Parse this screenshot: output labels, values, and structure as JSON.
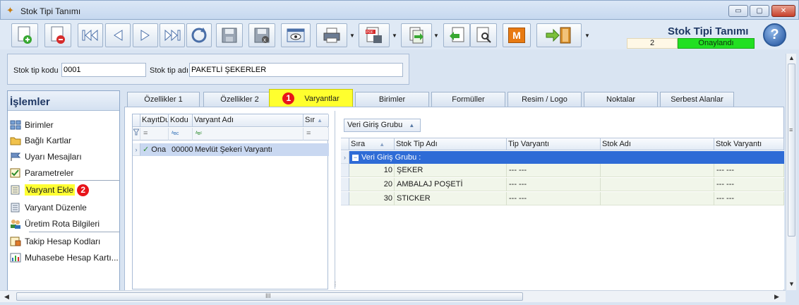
{
  "window": {
    "title": "Stok Tipi Tanımı",
    "minimize": "▭",
    "maximize": "▢",
    "close": "✕"
  },
  "toolbar": {
    "form_title": "Stok Tipi Tanımı",
    "record_number": "2",
    "status": "Onaylandı",
    "help_label": "?",
    "m_label": "M",
    "dropdown_arrow": "▼",
    "buttons": [
      "new-icon",
      "delete-icon",
      "first-icon",
      "prev-icon",
      "next-icon",
      "last-icon",
      "refresh-icon",
      "save-icon",
      "cancel-save-icon",
      "preview-icon",
      "print-icon",
      "pdf-icon",
      "export-icon",
      "import-icon",
      "tools-icon",
      "m-icon",
      "exit-icon"
    ]
  },
  "header": {
    "code_label": "Stok tip kodu",
    "code_value": "0001",
    "name_label": "Stok tip adı",
    "name_value": "PAKETLİ ŞEKERLER"
  },
  "left_panel": {
    "title": "İşlemler",
    "items": [
      {
        "label": "Birimler",
        "icon": "grid-icon"
      },
      {
        "label": "Bağlı Kartlar",
        "icon": "folder-icon"
      },
      {
        "label": "Uyarı Mesajları",
        "icon": "flag-icon"
      },
      {
        "label": "Parametreler",
        "icon": "checklist-icon"
      },
      {
        "label": "Varyant Ekle",
        "icon": "document-icon",
        "badge": "2"
      },
      {
        "label": "Varyant Düzenle",
        "icon": "document-icon"
      },
      {
        "label": "Üretim Rota Bilgileri",
        "icon": "users-icon"
      },
      {
        "label": "Takip Hesap Kodları",
        "icon": "ledger-icon"
      },
      {
        "label": "Muhasebe Hesap Kartı...",
        "icon": "chart-icon"
      }
    ]
  },
  "tabs": [
    {
      "label": "Özellikler 1"
    },
    {
      "label": "Özellikler 2"
    },
    {
      "label": "Varyantlar",
      "badge": "1"
    },
    {
      "label": "Birimler"
    },
    {
      "label": "Formüller"
    },
    {
      "label": "Resim / Logo"
    },
    {
      "label": "Noktalar"
    },
    {
      "label": "Serbest Alanlar"
    }
  ],
  "variant_grid": {
    "columns": [
      "KayıtDu",
      "Kodu",
      "Varyant Adı",
      "Sır"
    ],
    "filter_values": [
      "=",
      "ᴬʙᴄ",
      "ᴬʙᶜ",
      "="
    ],
    "rows": [
      {
        "status": "Ona",
        "code": "00000",
        "name": "Mevlüt Şekeri Varyantı"
      }
    ]
  },
  "detail_grid": {
    "group_button": "Veri Giriş Grubu",
    "columns": [
      "Sıra",
      "Stok Tip Adı",
      "Tip Varyantı",
      "Stok Adı",
      "Stok Varyantı"
    ],
    "group_label": "Veri Giriş Grubu :",
    "rows": [
      {
        "sira": "10",
        "stok_tip_adi": "ŞEKER",
        "tip_varyanti": "--- ---",
        "stok_adi": "",
        "stok_varyanti": "--- ---"
      },
      {
        "sira": "20",
        "stok_tip_adi": "AMBALAJ POŞETİ",
        "tip_varyanti": "--- ---",
        "stok_adi": "",
        "stok_varyanti": "--- ---"
      },
      {
        "sira": "30",
        "stok_tip_adi": "STICKER",
        "tip_varyanti": "--- ---",
        "stok_adi": "",
        "stok_varyanti": "--- ---"
      }
    ]
  },
  "scrollbar": {
    "h_grip": "III",
    "v_grip": "≡"
  },
  "colors": {
    "accent_blue": "#1f3864",
    "highlight_yellow": "#ffff2e",
    "status_green": "#22e022",
    "badge_red": "#e8141a",
    "group_row_blue": "#2e6bd6"
  }
}
